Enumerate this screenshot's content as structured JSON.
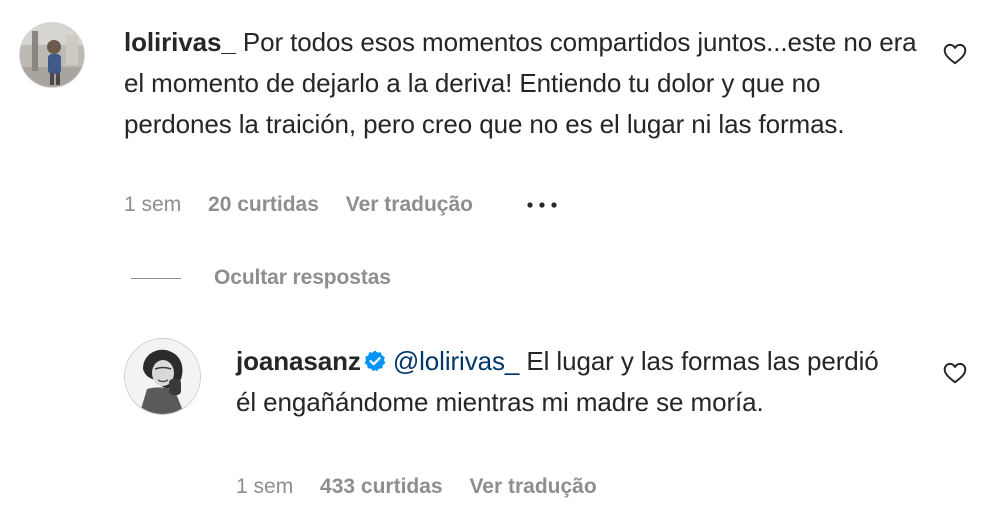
{
  "comment": {
    "username": "lolirivas_",
    "text": "Por todos esos momentos compartidos juntos...este no era el momento de dejarlo a la deriva! Entiendo tu dolor y que no perdones la traición, pero creo que no es el lugar ni las formas.",
    "time": "1 sem",
    "likes": "20 curtidas",
    "translate_label": "Ver tradução",
    "more_icon": "more-horizontal-icon",
    "like_icon": "heart-outline-icon"
  },
  "replies_toggle": {
    "label": "Ocultar respostas"
  },
  "reply": {
    "username": "joanasanz",
    "verified_icon": "verified-badge-icon",
    "verified_color": "#0095f6",
    "mention": "@lolirivas_",
    "text": "El lugar y las formas las perdió él engañándome mientras mi madre se moría.",
    "time": "1 sem",
    "likes": "433 curtidas",
    "translate_label": "Ver tradução",
    "like_icon": "heart-outline-icon"
  }
}
